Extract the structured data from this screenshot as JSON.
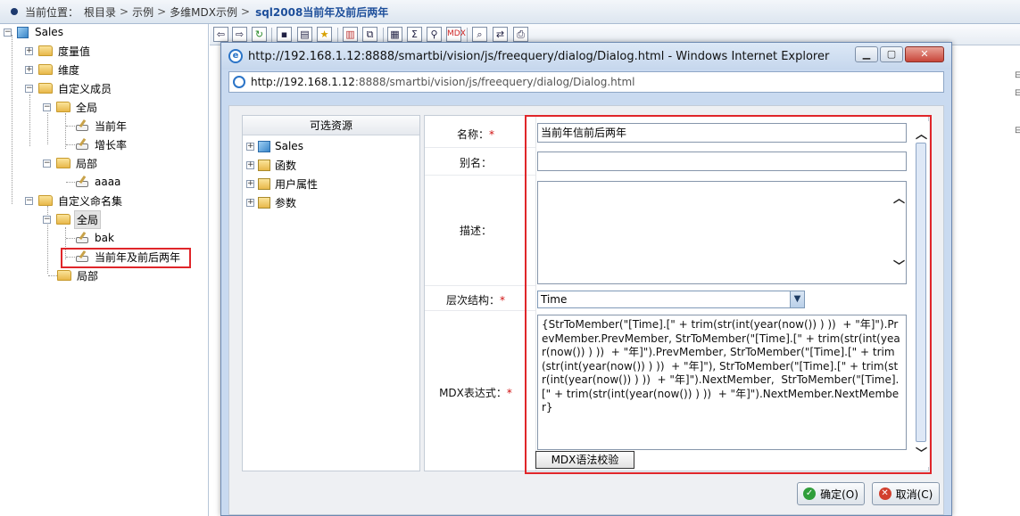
{
  "breadcrumb": {
    "prefix": "当前位置：",
    "items": [
      "根目录",
      "示例",
      "多维MDX示例"
    ],
    "separator": ">",
    "current": "sql2008当前年及前后两年"
  },
  "tree": {
    "root": "Sales",
    "measures": "度量值",
    "dimensions": "维度",
    "custom_members": "自定义成员",
    "global_1": "全局",
    "member_current_year": "当前年",
    "member_growth": "增长率",
    "local_1": "局部",
    "member_aaaa": "aaaa",
    "custom_sets": "自定义命名集",
    "global_2": "全局",
    "set_bak": "bak",
    "set_selected": "当前年及前后两年",
    "local_2": "局部"
  },
  "toolbar": {
    "icons": [
      "back-icon",
      "forward-icon",
      "refresh-icon",
      "save-icon",
      "save-as-icon",
      "favorite-icon",
      "chart-icon",
      "export-icon",
      "sum-icon",
      "filter-icon",
      "mdx-icon",
      "search-icon",
      "swap-icon",
      "print-icon"
    ]
  },
  "dialog": {
    "title": "http://192.168.1.12:8888/smartbi/vision/js/freequery/dialog/Dialog.html - Windows Internet Explorer",
    "address_host": "http://192.168.1.12",
    "address_rest": ":8888/smartbi/vision/js/freequery/dialog/Dialog.html",
    "resources_title": "可选资源",
    "resources": [
      "Sales",
      "函数",
      "用户属性",
      "参数"
    ],
    "form": {
      "name_label": "名称：",
      "name_value": "当前年信前后两年",
      "alias_label": "别名：",
      "alias_value": "",
      "desc_label": "描述：",
      "desc_value": "",
      "hierarchy_label": "层次结构：",
      "hierarchy_value": "Time",
      "mdx_label": "MDX表达式：",
      "mdx_value": "{StrToMember(\"[Time].[\" + trim(str(int(year(now()) ) ))  + \"年]\").PrevMember.PrevMember, StrToMember(\"[Time].[\" + trim(str(int(year(now()) ) ))  + \"年]\").PrevMember, StrToMember(\"[Time].[\" + trim(str(int(year(now()) ) ))  + \"年]\"), StrToMember(\"[Time].[\" + trim(str(int(year(now()) ) ))  + \"年]\").NextMember,  StrToMember(\"[Time].[\" + trim(str(int(year(now()) ) ))  + \"年]\").NextMember.NextMember}",
      "required_mark": "*",
      "mdx_check_button": "MDX语法校验"
    },
    "ok_button": "确定(O)",
    "cancel_button": "取消(C)"
  },
  "colors": {
    "highlight_red": "#e0262a",
    "ok_green": "#2f9e3a",
    "cancel_red": "#d2402e"
  }
}
